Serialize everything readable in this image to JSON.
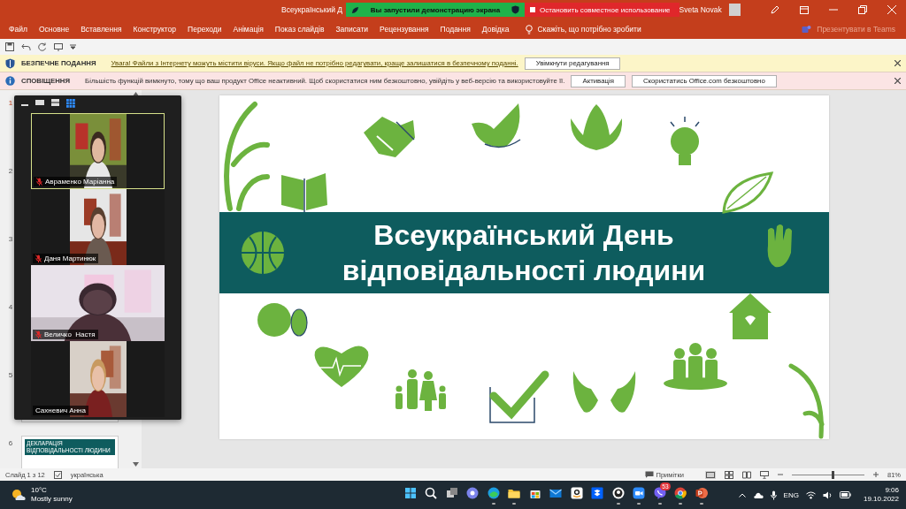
{
  "window": {
    "title": "Всеукраїнський Д",
    "user": "Sveta Novak"
  },
  "share_banner": {
    "status": "Вы запустили демонстрацию экрана",
    "stop": "Остановить совместное использование"
  },
  "ribbon": {
    "tabs": [
      "Файл",
      "Основне",
      "Вставлення",
      "Конструктор",
      "Переходи",
      "Анімація",
      "Показ слайдів",
      "Записати",
      "Рецензування",
      "Подання",
      "Довідка"
    ],
    "tell_me": "Скажіть, що потрібно зробити",
    "present_teams": "Презентувати в Teams"
  },
  "message_bars": [
    {
      "kind": "warning",
      "title": "БЕЗПЕЧНЕ ПОДАННЯ",
      "text": "Увага! Файли з Інтернету можуть містити віруси. Якщо файл не потрібно редагувати, краще залишатися в безпечному поданні.",
      "buttons": [
        "Увімкнути редагування"
      ]
    },
    {
      "kind": "notice",
      "title": "СПОВІЩЕННЯ",
      "text": "Більшість функцій вимкнуто, тому що ваш продукт Office неактивний. Щоб скористатися ним безкоштовно, увійдіть у веб-версію та використовуйте її.",
      "buttons": [
        "Активація",
        "Скористатись Office.com безкоштовно"
      ]
    }
  ],
  "thumbnails": [
    {
      "number": "1",
      "selected": true,
      "kind": "covered"
    },
    {
      "number": "2",
      "selected": false,
      "kind": "covered"
    },
    {
      "number": "3",
      "selected": false,
      "kind": "covered"
    },
    {
      "number": "4",
      "selected": false,
      "kind": "covered"
    },
    {
      "number": "5",
      "selected": false,
      "kind": "slide"
    },
    {
      "number": "6",
      "selected": false,
      "kind": "slide",
      "caption": "ДЕКЛАРАЦІЯ ВІДПОВІДАЛЬНОСТІ ЛЮДИНИ"
    }
  ],
  "video_call": {
    "participants": [
      {
        "name": "Авраменко Маріанна",
        "muted": true,
        "selected": true,
        "kind": "portrait"
      },
      {
        "name": "Даня Мартинюк",
        "muted": true,
        "selected": false,
        "kind": "portrait"
      },
      {
        "name": "Величко  Настя",
        "muted": true,
        "selected": false,
        "kind": "landscape"
      },
      {
        "name": "Сахневич Анна",
        "muted": false,
        "selected": false,
        "kind": "portrait"
      }
    ]
  },
  "slide": {
    "title_lines": [
      "Всеукраїнський День",
      "відповідальності людини"
    ]
  },
  "status_bar": {
    "slide": "Слайд 1 з 12",
    "language": "українська",
    "notes": "Примітки",
    "zoom_slider": {
      "level": 0.55
    },
    "zoom": "81%"
  },
  "taskbar": {
    "weather": {
      "temperature": "10°C",
      "condition": "Mostly sunny"
    },
    "apps": [
      {
        "kind": "start",
        "running": false
      },
      {
        "kind": "search",
        "running": false
      },
      {
        "kind": "taskview",
        "running": false
      },
      {
        "kind": "chat",
        "running": false
      },
      {
        "kind": "edge",
        "running": true
      },
      {
        "kind": "explorer",
        "running": true
      },
      {
        "kind": "store",
        "running": false
      },
      {
        "kind": "mail",
        "running": false
      },
      {
        "kind": "amazon",
        "running": false
      },
      {
        "kind": "dropbox",
        "running": false
      },
      {
        "kind": "ring",
        "running": true
      },
      {
        "kind": "zoom",
        "running": true
      },
      {
        "kind": "viber",
        "running": true,
        "badge": "53"
      },
      {
        "kind": "chrome",
        "running": true
      },
      {
        "kind": "powerpoint",
        "running": true
      }
    ],
    "language": "ENG",
    "time": "9:06",
    "date": "19.10.2022"
  }
}
